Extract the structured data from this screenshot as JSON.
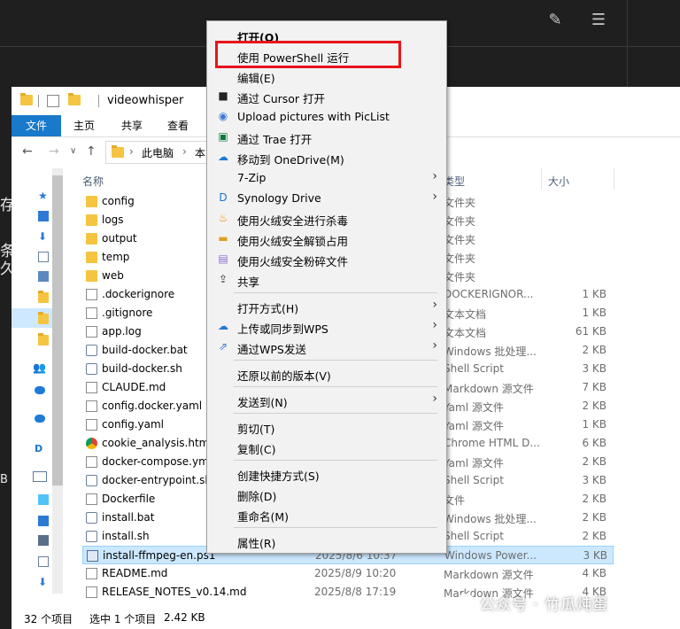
{
  "top_bar": {
    "icons": [
      "pencil-icon",
      "list-icon"
    ]
  },
  "background_fragments": [
    "存",
    "条久",
    "B"
  ],
  "explorer": {
    "title": "videowhisper",
    "ribbon": {
      "file": "文件",
      "home": "主页",
      "share": "共享",
      "view": "查看"
    },
    "address": {
      "root": "此电脑",
      "next": "本"
    },
    "columns": {
      "name": "名称",
      "type": "类型",
      "size": "大小"
    },
    "files": [
      {
        "name": "config",
        "date": "",
        "type": "文件夹",
        "size": "",
        "icon": "folder-icon"
      },
      {
        "name": "logs",
        "date": "",
        "type": "文件夹",
        "size": "",
        "icon": "folder-icon"
      },
      {
        "name": "output",
        "date": "",
        "type": "文件夹",
        "size": "",
        "icon": "folder-icon"
      },
      {
        "name": "temp",
        "date": "",
        "type": "文件夹",
        "size": "",
        "icon": "folder-icon"
      },
      {
        "name": "web",
        "date": "",
        "type": "文件夹",
        "size": "",
        "icon": "folder-icon"
      },
      {
        "name": ".dockerignore",
        "date": "",
        "type": "DOCKERIGNOR...",
        "size": "1 KB",
        "icon": "file-icon"
      },
      {
        "name": ".gitignore",
        "date": "",
        "type": "文本文档",
        "size": "1 KB",
        "icon": "file-icon"
      },
      {
        "name": "app.log",
        "date": "",
        "type": "文本文档",
        "size": "61 KB",
        "icon": "file-icon"
      },
      {
        "name": "build-docker.bat",
        "date": "",
        "type": "Windows 批处理...",
        "size": "2 KB",
        "icon": "gear-file-icon"
      },
      {
        "name": "build-docker.sh",
        "date": "",
        "type": "Shell Script",
        "size": "3 KB",
        "icon": "gear-file-icon"
      },
      {
        "name": "CLAUDE.md",
        "date": "",
        "type": "Markdown 源文件",
        "size": "7 KB",
        "icon": "file-icon"
      },
      {
        "name": "config.docker.yaml",
        "date": "",
        "type": "Yaml 源文件",
        "size": "2 KB",
        "icon": "file-icon"
      },
      {
        "name": "config.yaml",
        "date": "",
        "type": "Yaml 源文件",
        "size": "1 KB",
        "icon": "file-icon"
      },
      {
        "name": "cookie_analysis.html",
        "date": "",
        "type": "Chrome HTML D...",
        "size": "6 KB",
        "icon": "chrome-icon"
      },
      {
        "name": "docker-compose.yml",
        "date": "",
        "type": "Yaml 源文件",
        "size": "2 KB",
        "icon": "file-icon"
      },
      {
        "name": "docker-entrypoint.sh",
        "date": "",
        "type": "Shell Script",
        "size": "3 KB",
        "icon": "gear-file-icon"
      },
      {
        "name": "Dockerfile",
        "date": "",
        "type": "文件",
        "size": "2 KB",
        "icon": "file-icon"
      },
      {
        "name": "install.bat",
        "date": "",
        "type": "Windows 批处理...",
        "size": "2 KB",
        "icon": "gear-file-icon"
      },
      {
        "name": "install.sh",
        "date": "",
        "type": "Shell Script",
        "size": "2 KB",
        "icon": "gear-file-icon"
      },
      {
        "name": "install-ffmpeg-en.ps1",
        "date": "2025/8/6 10:37",
        "type": "Windows Power...",
        "size": "3 KB",
        "icon": "powershell-file-icon",
        "selected": true
      },
      {
        "name": "README.md",
        "date": "2025/8/9 10:20",
        "type": "Markdown 源文件",
        "size": "4 KB",
        "icon": "file-icon"
      },
      {
        "name": "RELEASE_NOTES_v0.14.md",
        "date": "2025/8/8 17:19",
        "type": "Markdown 源文件",
        "size": "4 KB",
        "icon": "file-icon"
      }
    ],
    "status": {
      "count": "32 个项目",
      "selected": "选中 1 个项目",
      "size": "2.42 KB"
    }
  },
  "context_menu": {
    "items": [
      {
        "label": "打开(O)",
        "icon": "",
        "bold": true
      },
      {
        "label": "使用 PowerShell 运行",
        "icon": ""
      },
      {
        "label": "编辑(E)",
        "icon": ""
      },
      {
        "label": "通过 Cursor 打开",
        "icon": "cursor-icon"
      },
      {
        "label": "Upload pictures with PicList",
        "icon": "piclist-icon"
      },
      {
        "label": "通过 Trae 打开",
        "icon": "trae-icon"
      },
      {
        "label": "移动到 OneDrive(M)",
        "icon": "onedrive-icon"
      },
      {
        "label": "7-Zip",
        "icon": "",
        "submenu": true
      },
      {
        "label": "Synology Drive",
        "icon": "synology-icon",
        "submenu": true
      },
      {
        "label": "使用火绒安全进行杀毒",
        "icon": "huorong-icon"
      },
      {
        "label": "使用火绒安全解锁占用",
        "icon": "unlock-icon"
      },
      {
        "label": "使用火绒安全粉碎文件",
        "icon": "shred-icon"
      },
      {
        "label": "共享",
        "icon": "share-icon"
      },
      {
        "label": "打开方式(H)",
        "icon": "",
        "submenu": true
      },
      {
        "label": "上传或同步到WPS",
        "icon": "wps-cloud-icon",
        "submenu": true
      },
      {
        "label": "通过WPS发送",
        "icon": "wps-send-icon",
        "submenu": true
      },
      {
        "label": "还原以前的版本(V)",
        "icon": ""
      },
      {
        "label": "发送到(N)",
        "icon": "",
        "submenu": true
      },
      {
        "label": "剪切(T)",
        "icon": ""
      },
      {
        "label": "复制(C)",
        "icon": ""
      },
      {
        "label": "创建快捷方式(S)",
        "icon": ""
      },
      {
        "label": "删除(D)",
        "icon": ""
      },
      {
        "label": "重命名(M)",
        "icon": ""
      },
      {
        "label": "属性(R)",
        "icon": ""
      }
    ],
    "highlight_color": "#e8141b"
  },
  "watermark": "公众号 · 竹瓜炖蛋"
}
